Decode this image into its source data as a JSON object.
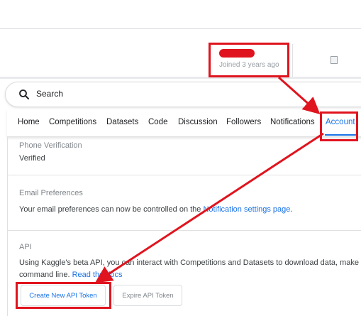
{
  "profile": {
    "joined_text": "Joined 3 years ago"
  },
  "search": {
    "placeholder": "Search"
  },
  "tabs": [
    {
      "label": "Home"
    },
    {
      "label": "Competitions"
    },
    {
      "label": "Datasets"
    },
    {
      "label": "Code"
    },
    {
      "label": "Discussion"
    },
    {
      "label": "Followers"
    },
    {
      "label": "Notifications"
    },
    {
      "label": "Account",
      "active": true
    }
  ],
  "phone": {
    "title": "Phone Verification",
    "status": "Verified"
  },
  "email": {
    "title": "Email Preferences",
    "text": "Your email preferences can now be controlled on the ",
    "link": "Notification settings page",
    "suffix": "."
  },
  "api": {
    "title": "API",
    "text_line1": "Using Kaggle's beta API, you can interact with Competitions and Datasets to download data, make",
    "text_line2": "command line. ",
    "docs_link": "Read the docs",
    "create_button": "Create New API Token",
    "expire_button": "Expire API Token"
  },
  "colors": {
    "accent": "#1a73e8",
    "annotation": "#e0141e"
  }
}
